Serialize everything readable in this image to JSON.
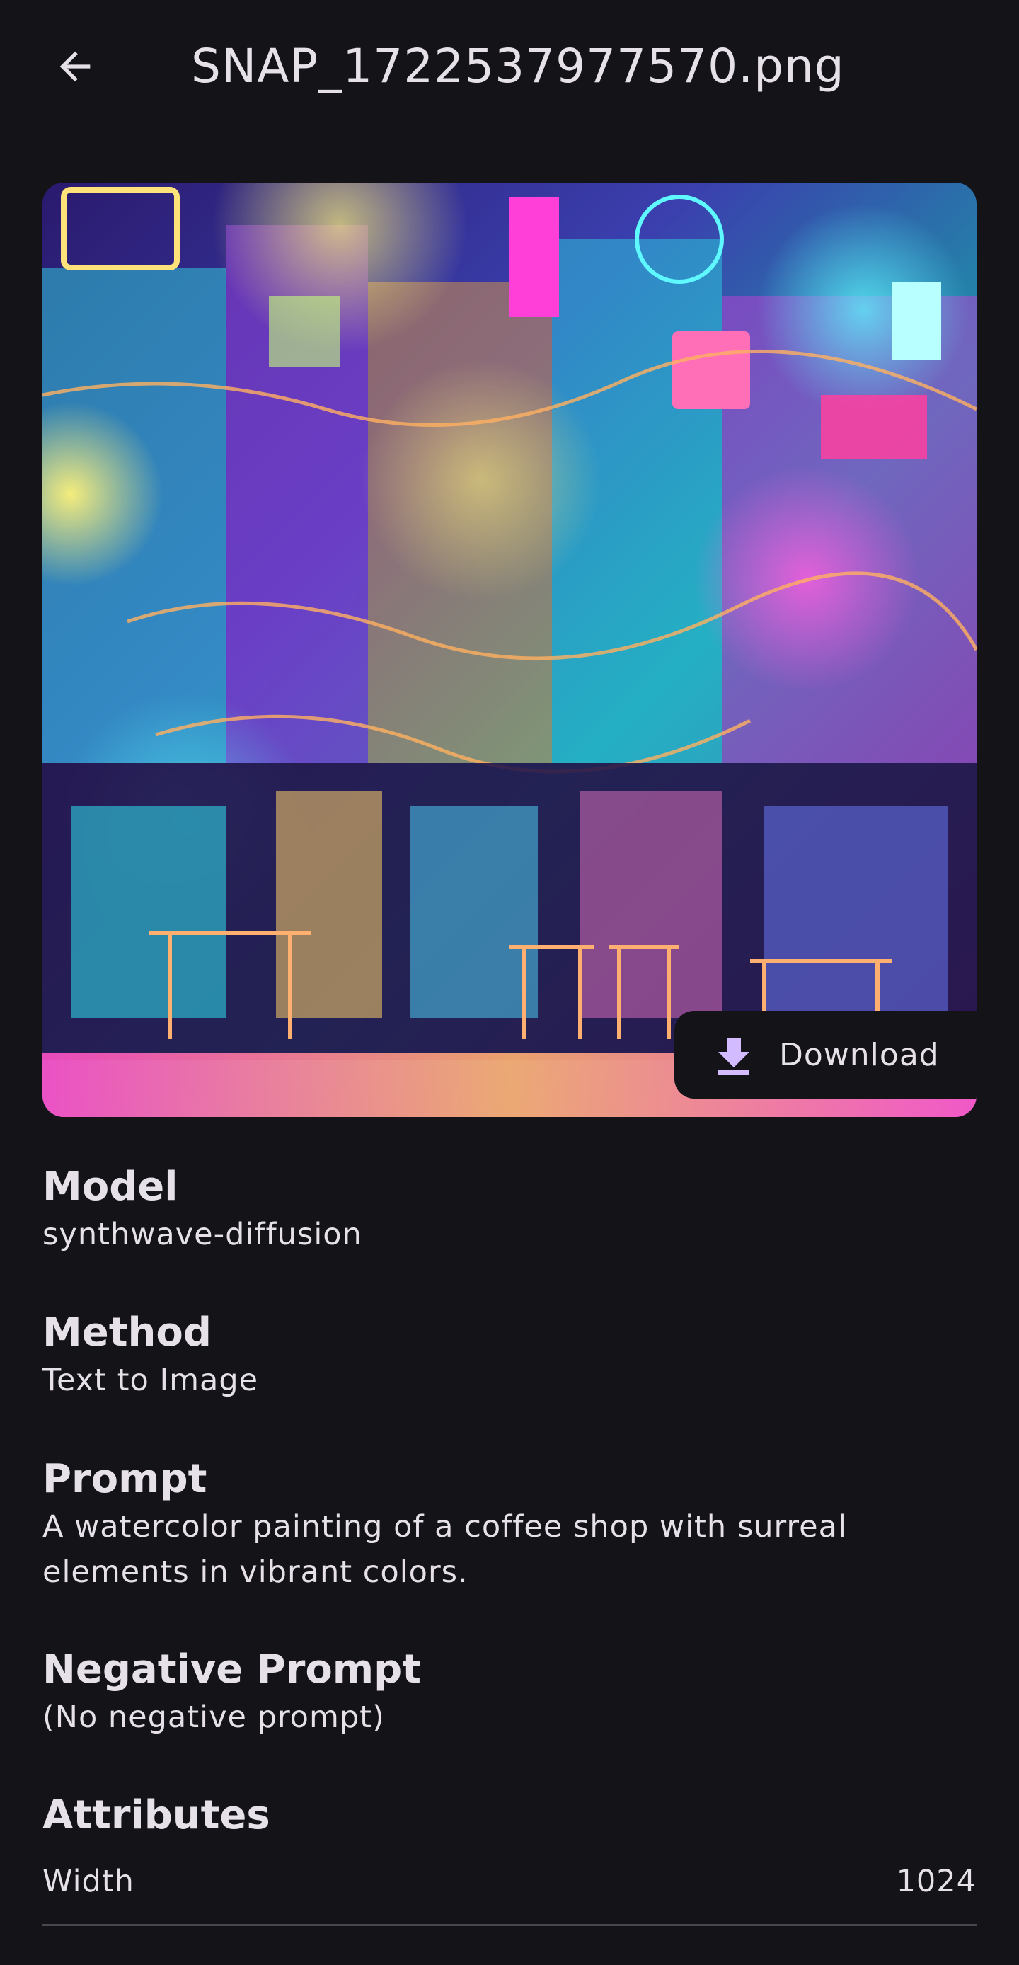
{
  "header": {
    "title": "SNAP_1722537977570.png",
    "back_icon": "arrow-back-icon"
  },
  "image": {
    "download_label": "Download",
    "download_icon": "download-icon"
  },
  "details": {
    "model": {
      "label": "Model",
      "value": "synthwave-diffusion"
    },
    "method": {
      "label": "Method",
      "value": "Text to Image"
    },
    "prompt": {
      "label": "Prompt",
      "line1": "A watercolor painting of a coffee shop with surreal",
      "line2": "elements in vibrant colors."
    },
    "negative_prompt": {
      "label": "Negative Prompt",
      "value": "(No negative prompt)"
    },
    "attributes": {
      "label": "Attributes",
      "rows": [
        {
          "name": "Width",
          "value": "1024"
        }
      ]
    }
  },
  "colors": {
    "background": "#141318",
    "text": "#e6e1e9",
    "accent": "#d3bbff"
  }
}
